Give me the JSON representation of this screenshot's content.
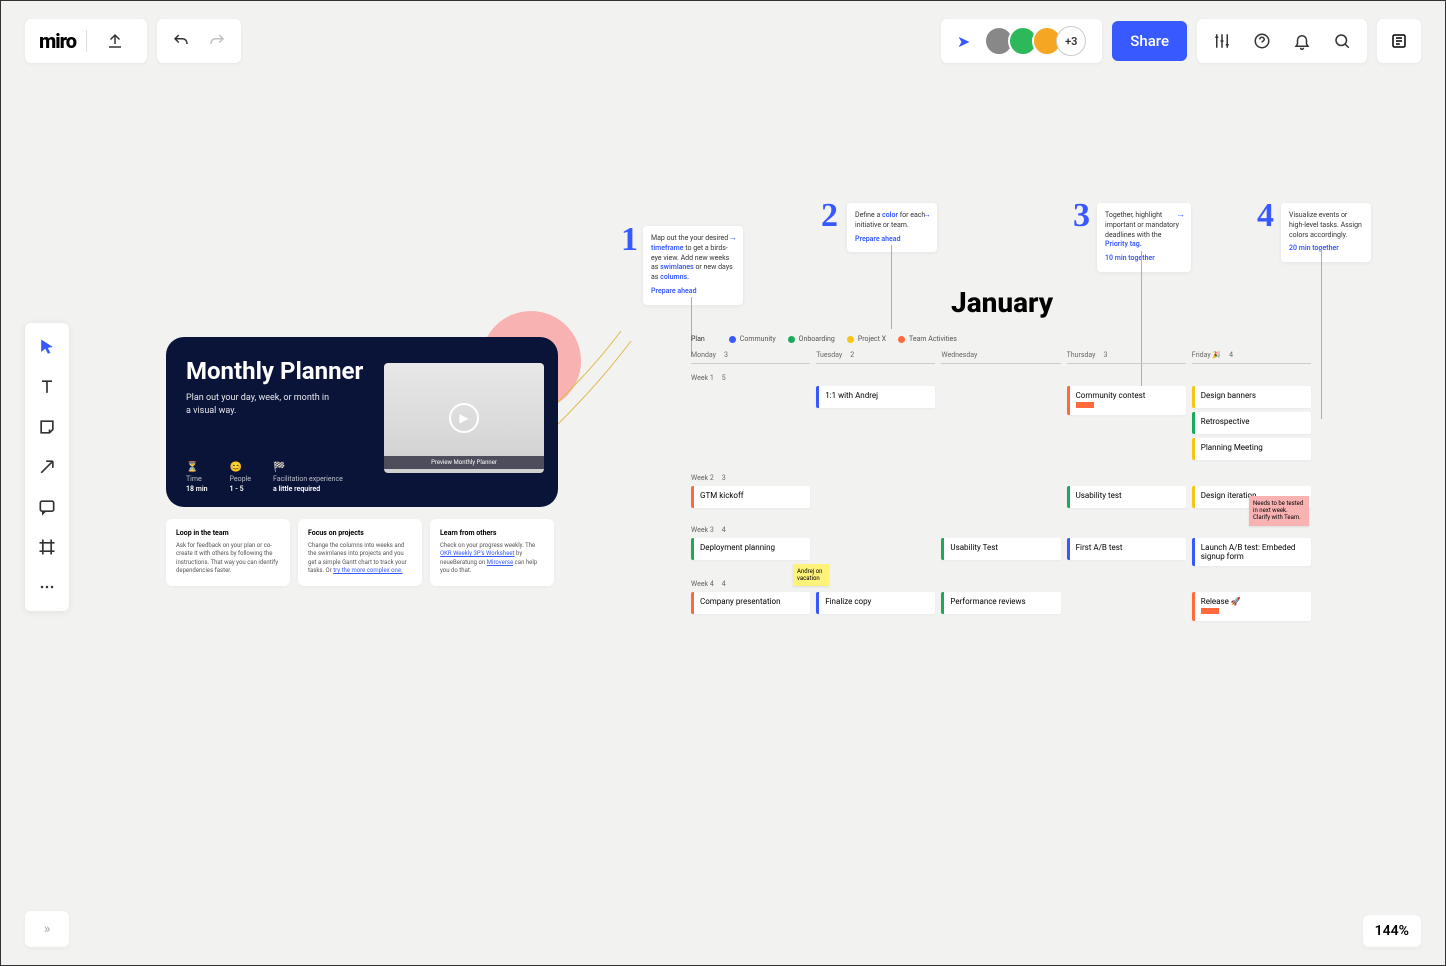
{
  "header": {
    "logo": "miro",
    "share_label": "Share",
    "more_avatars": "+3"
  },
  "tooltips": {
    "upload": "Upload",
    "undo": "Undo",
    "redo": "Redo",
    "settings": "Settings",
    "help": "Help",
    "notifications": "Notifications",
    "search": "Search",
    "activity": "Activity"
  },
  "zoom": "144%",
  "intro": {
    "title": "Monthly Planner",
    "subtitle": "Plan out your day, week, or month in a visual way.",
    "meta": {
      "time_label": "Time",
      "time_val": "18 min",
      "people_label": "People",
      "people_val": "1 - 5",
      "fac_label": "Facilitation experience",
      "fac_val": "a little required"
    },
    "thumb_caption": "Preview Monthly Planner"
  },
  "tips": [
    {
      "title": "Loop in the team",
      "body": "Ask for feedback on your plan or co-create it with others by following the instructions. That way you can identify dependencies faster."
    },
    {
      "title": "Focus on projects",
      "body": "Change the columns into weeks and the swimlanes into projects and you get a simple Gantt chart to track your tasks. Or ",
      "link": "try the more complex one."
    },
    {
      "title": "Learn from others",
      "body": "Check on your progress weekly. The ",
      "link1": "OKR Weekly 3P's Worksheet",
      "mid": " by neueBeratung on ",
      "link2": "Miroverse",
      "tail": " can help you do that."
    }
  ],
  "hints": {
    "h1": {
      "num": "1",
      "text_a": "Map out the your desired ",
      "b1": "timeframe",
      "text_b": " to get a birds-eye view. Add new weeks as ",
      "b2": "swimlanes",
      "text_c": " or new days as ",
      "b3": "columns.",
      "link": "Prepare ahead"
    },
    "h2": {
      "num": "2",
      "text_a": "Define a ",
      "b1": "color",
      "text_b": " for each initiative or team.",
      "link": "Prepare ahead"
    },
    "h3": {
      "num": "3",
      "text_a": "Together, highlight important or mandatory deadlines with the ",
      "b1": "Priority tag.",
      "link": "10 min together"
    },
    "h4": {
      "num": "4",
      "text_a": "Visualize events or high-level tasks. Assign colors accordingly.",
      "link": "20 min together"
    }
  },
  "calendar": {
    "month": "January",
    "legend_label": "Plan",
    "legend": [
      {
        "name": "Community",
        "color": "#3859ff"
      },
      {
        "name": "Onboarding",
        "color": "#1aab5a"
      },
      {
        "name": "Project X",
        "color": "#f5c518"
      },
      {
        "name": "Team Activities",
        "color": "#ff6a3d"
      }
    ],
    "days": [
      {
        "name": "Monday",
        "date": "3"
      },
      {
        "name": "Tuesday",
        "date": "2"
      },
      {
        "name": "Wednesday",
        "date": ""
      },
      {
        "name": "Thursday",
        "date": "3"
      },
      {
        "name": "Friday 🎉",
        "date": "4"
      }
    ],
    "weeks": [
      {
        "label": "Week 1",
        "date": "5",
        "cells": [
          [],
          [
            {
              "text": "1:1 with Andrej",
              "color": "#3859ff"
            }
          ],
          [],
          [
            {
              "text": "Community contest",
              "color": "#ff6a3d",
              "tag": true
            }
          ],
          [
            {
              "text": "Design banners",
              "color": "#f5c518"
            },
            {
              "text": "Retrospective",
              "color": "#1aab5a"
            },
            {
              "text": "Planning Meeting",
              "color": "#f5c518"
            }
          ]
        ]
      },
      {
        "label": "Week 2",
        "date": "3",
        "cells": [
          [
            {
              "text": "GTM kickoff",
              "color": "#ff6a3d"
            }
          ],
          [],
          [],
          [
            {
              "text": "Usability test",
              "color": "#1aab5a"
            }
          ],
          [
            {
              "text": "Design iteration",
              "color": "#f5c518"
            }
          ]
        ]
      },
      {
        "label": "Week 3",
        "date": "4",
        "cells": [
          [
            {
              "text": "Deployment planning",
              "color": "#1aab5a"
            }
          ],
          [],
          [
            {
              "text": "Usability Test",
              "color": "#1aab5a"
            }
          ],
          [
            {
              "text": "First A/B test",
              "color": "#3859ff"
            }
          ],
          [
            {
              "text": "Launch A/B test: Embeded signup form",
              "color": "#3859ff"
            }
          ]
        ]
      },
      {
        "label": "Week 4",
        "date": "4",
        "cells": [
          [
            {
              "text": "Company presentation",
              "color": "#ff6a3d"
            }
          ],
          [
            {
              "text": "Finalize copy",
              "color": "#3859ff"
            }
          ],
          [
            {
              "text": "Performance reviews",
              "color": "#1aab5a"
            }
          ],
          [],
          [
            {
              "text": "Release 🚀",
              "color": "#ff6a3d",
              "tag": true
            }
          ]
        ]
      }
    ],
    "stickies": {
      "yellow": "Andrej on vacation",
      "pink": "Needs to be tested in next week. Clarify with Team."
    }
  }
}
